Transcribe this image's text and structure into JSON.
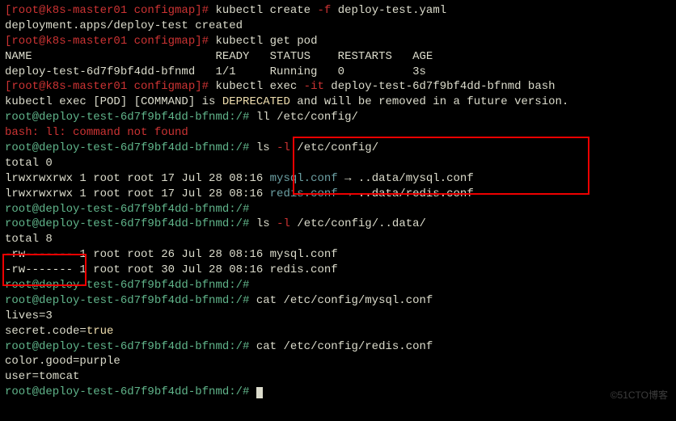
{
  "l1": {
    "prompt": "[root@k8s-master01 configmap]# ",
    "cmd1": "kubectl create ",
    "flag": "-f",
    "cmd2": " deploy-test.yaml"
  },
  "l2": "deployment.apps/deploy-test created",
  "l3": {
    "prompt": "[root@k8s-master01 configmap]# ",
    "cmd": "kubectl get pod"
  },
  "l4": "NAME                           READY   STATUS    RESTARTS   AGE",
  "l5": "deploy-test-6d7f9bf4dd-bfnmd   1/1     Running   0          3s",
  "l6": {
    "prompt": "[root@k8s-master01 configmap]# ",
    "cmd1": "kubectl exec ",
    "flag": "-it",
    "cmd2": " deploy-test-6d7f9bf4dd-bfnmd bash"
  },
  "l7": {
    "p1": "kubectl exec [POD] [COMMAND] is ",
    "dep": "DEPRECATED",
    "p2": " and will be removed in a future version."
  },
  "l8": {
    "prompt": "root@deploy-test-6d7f9bf4dd-bfnmd:/# ",
    "cmd": "ll /etc/config/"
  },
  "l9": "bash: ll: command not found",
  "l10": {
    "prompt": "root@deploy-test-6d7f9bf4dd-bfnmd:/# ",
    "cmd1": "ls ",
    "flag": "-l",
    "cmd2": " /etc/config/"
  },
  "l11": "total 0",
  "l12": {
    "perm": "lrwxrwxrwx 1 root root 17 Jul 28 08:16 ",
    "name": "mysql.conf",
    "arrow": " → ",
    "target": "..data/mysql.conf"
  },
  "l13": {
    "perm": "lrwxrwxrwx 1 root root 17 Jul 28 08:16 ",
    "name": "redis.conf",
    "arrow": " → ",
    "target": "..data/redis.conf"
  },
  "l14": "root@deploy-test-6d7f9bf4dd-bfnmd:/#",
  "l15": {
    "prompt": "root@deploy-test-6d7f9bf4dd-bfnmd:/# ",
    "cmd1": "ls ",
    "flag": "-l",
    "cmd2": " /etc/config/..data/"
  },
  "l16": "total 8",
  "l17": "-rw------- 1 root root 26 Jul 28 08:16 mysql.conf",
  "l18": "-rw------- 1 root root 30 Jul 28 08:16 redis.conf",
  "l19": "root@deploy-test-6d7f9bf4dd-bfnmd:/#",
  "l20": {
    "prompt": "root@deploy-test-6d7f9bf4dd-bfnmd:/# ",
    "cmd": "cat /etc/config/mysql.conf"
  },
  "l21": "lives=3",
  "l22": {
    "p1": "secret.code=",
    "val": "true"
  },
  "l23": "",
  "l24": {
    "prompt": "root@deploy-test-6d7f9bf4dd-bfnmd:/# ",
    "cmd": "cat /etc/config/redis.conf"
  },
  "l25": "color.good=purple",
  "l26": "user=tomcat",
  "l27": "root@deploy-test-6d7f9bf4dd-bfnmd:/# ",
  "watermark": "©51CTO博客"
}
